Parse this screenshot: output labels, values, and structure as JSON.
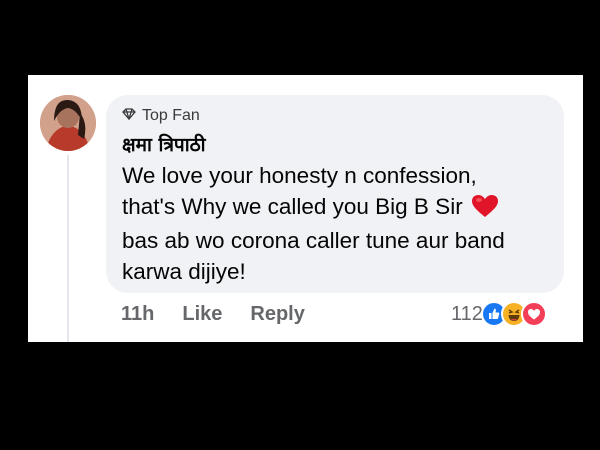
{
  "comment": {
    "badge_label": "Top Fan",
    "author_name": "क्षमा त्रिपाठी",
    "lines": [
      "We love your honesty n confession,",
      "that's Why we called you Big B Sir",
      "bas ab wo corona caller tune aur band",
      "karwa dijiye!"
    ],
    "inline_icon": "red-heart-emoji",
    "time": "11h",
    "like_label": "Like",
    "reply_label": "Reply",
    "reaction_count": "112",
    "reaction_icons": [
      "like-icon",
      "haha-icon",
      "love-icon"
    ]
  },
  "colors": {
    "bubble": "#f0f2f5",
    "text": "#050505",
    "meta_text": "#65676b",
    "like_blue": "#1877f2",
    "haha_yellow": "#f7b125",
    "love_red": "#f33e58"
  }
}
